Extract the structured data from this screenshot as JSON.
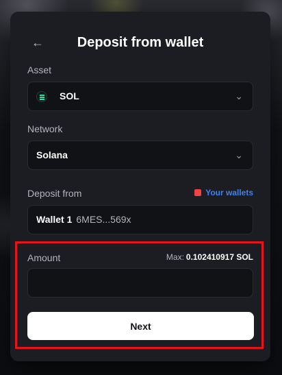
{
  "modal": {
    "title": "Deposit from wallet",
    "back_icon": "arrow-left-icon"
  },
  "asset": {
    "label": "Asset",
    "value": "SOL",
    "icon": "solana-token-icon"
  },
  "network": {
    "label": "Network",
    "value": "Solana"
  },
  "deposit_from": {
    "label": "Deposit from",
    "your_wallets_label": "Your wallets",
    "wallet_name": "Wallet 1",
    "wallet_address": "6MES...569x"
  },
  "amount": {
    "label": "Amount",
    "max_label": "Max:",
    "max_value": "0.102410917 SOL",
    "value": "",
    "placeholder": ""
  },
  "next_label": "Next",
  "colors": {
    "accent_link": "#3b82f6",
    "highlight": "#e3141b",
    "modal_bg": "#1c1d22",
    "field_bg": "#111216"
  }
}
